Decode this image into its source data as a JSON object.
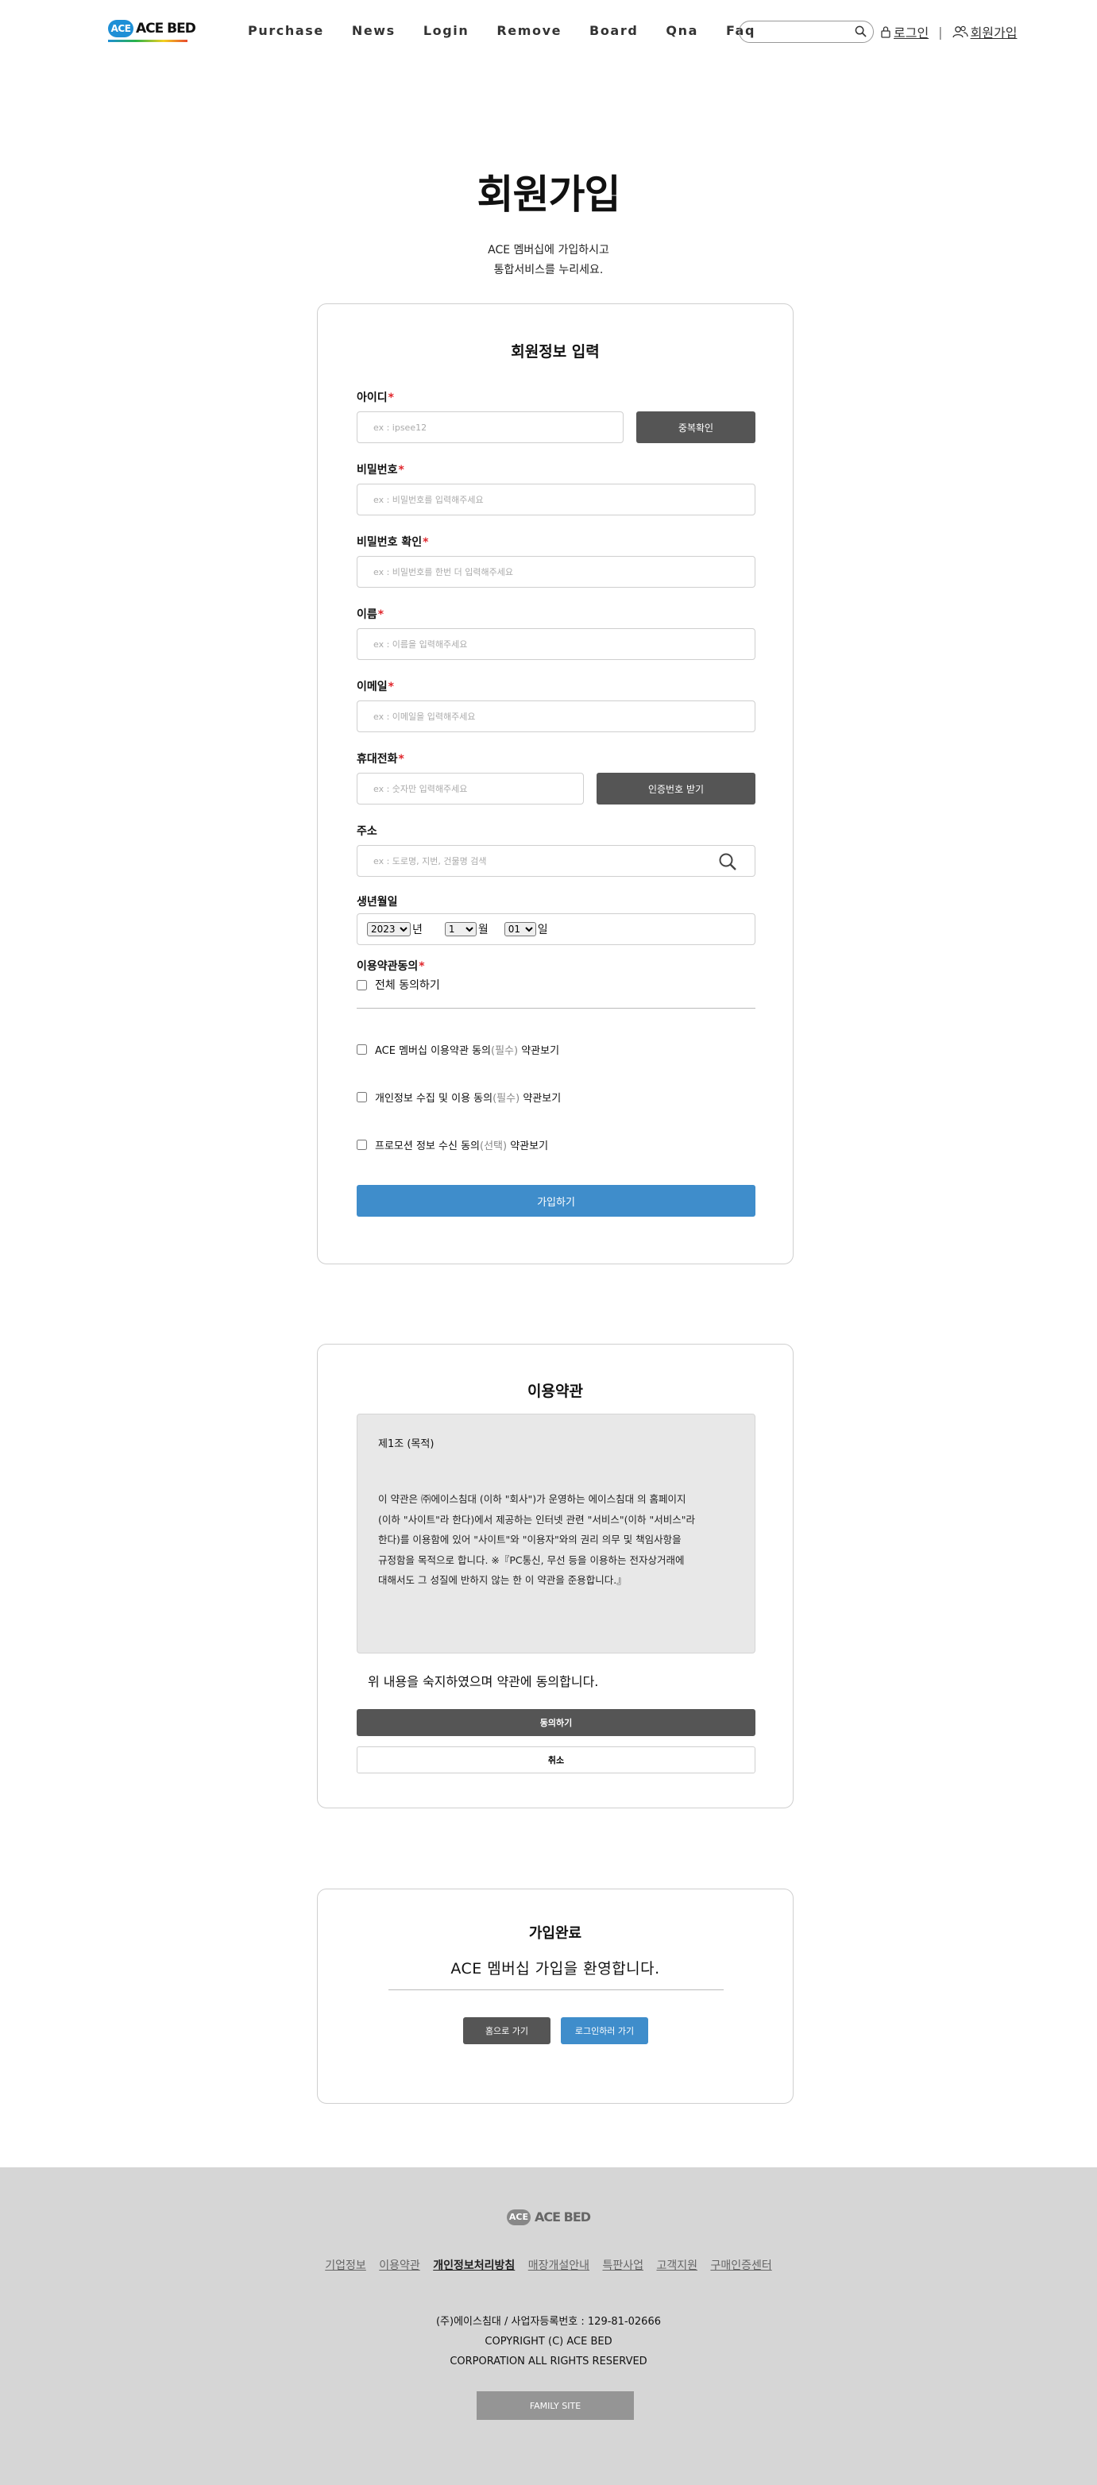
{
  "header": {
    "logo_badge": "ACE",
    "logo_text": "ACE BED",
    "nav": [
      "Purchase",
      "News",
      "Login",
      "Remove",
      "Board",
      "Qna",
      "Faq"
    ],
    "login_label": "로그인",
    "join_label": "회원가입"
  },
  "hero": {
    "title": "회원가입",
    "sub_line1": "ACE 멤버십에 가입하시고",
    "sub_line2": "통합서비스를 누리세요."
  },
  "form": {
    "title": "회원정보 입력",
    "id_label": "아이디",
    "id_placeholder": "ex : ipsee12",
    "dup_check": "중복확인",
    "pw_label": "비밀번호",
    "pw_placeholder": "ex : 비밀번호를 입력해주세요",
    "pw2_label": "비밀번호 확인",
    "pw2_placeholder": "ex : 비밀번호를 한번 더 입력해주세요",
    "name_label": "이름",
    "name_placeholder": "ex : 이름을 입력해주세요",
    "email_label": "이메일",
    "email_placeholder": "ex : 이메일을 입력해주세요",
    "phone_label": "휴대전화",
    "phone_placeholder": "ex : 숫자만 입력해주세요",
    "verify_button": "인증번호 받기",
    "addr_label": "주소",
    "addr_placeholder": "ex : 도로명, 지번, 건물명 검색",
    "birth_label": "생년월일",
    "birth_year": "2023",
    "birth_year_unit": "년",
    "birth_month": "1",
    "birth_month_unit": "월",
    "birth_day": "01",
    "birth_day_unit": "일",
    "agree_label": "이용약관동의",
    "agree_all": "전체 동의하기",
    "terms1_prefix": "ACE 멤버십 이용약관 동의",
    "terms1_opt": "(필수)",
    "terms1_view": "약관보기",
    "terms2_prefix": "개인정보 수집 및 이용 동의",
    "terms2_opt": "(필수)",
    "terms2_view": "약관보기",
    "terms3_prefix": "프로모션 정보 수신 동의",
    "terms3_opt": "(선택)",
    "terms3_view": "약관보기",
    "submit": "가입하기",
    "required_mark": "*"
  },
  "terms": {
    "title": "이용약관",
    "article": "제1조 (목적)",
    "line1": "이 약관은 ㈜에이스침대 (이하 \"회사\")가 운영하는 에이스침대 의 홈페이지",
    "line2": "(이하 \"사이트\"라 한다)에서 제공하는 인터넷 관련 \"서비스\"(이하 \"서비스\"라",
    "line3": "한다)를 이용함에 있어 \"사이트\"와 \"이용자\"와의 권리 의무 및 책임사항을",
    "line4": "규정함을 목적으로 합니다. ※『PC통신, 무선 등을 이용하는 전자상거래에",
    "line5": "대해서도 그 성질에 반하지 않는 한 이 약관을 준용합니다.』",
    "confirm_text": "위 내용을 숙지하였으며 약관에 동의합니다.",
    "agree_button": "동의하기",
    "cancel_button": "취소"
  },
  "complete": {
    "title": "가입완료",
    "message": "ACE 멤버십 가입을 환영합니다.",
    "home_button": "홈으로 가기",
    "login_button": "로그인하러 가기"
  },
  "footer": {
    "logo_badge": "ACE",
    "logo_text": "ACE BED",
    "links": [
      "기업정보",
      "이용약관",
      "개인정보처리방침",
      "매장개설안내",
      "특판사업",
      "고객지원",
      "구매인증센터"
    ],
    "company_line": "(주)에이스침대 / 사업자등록번호 : 129-81-02666",
    "copyright1": "COPYRIGHT (C) ACE BED",
    "copyright2": "CORPORATION ALL RIGHTS RESERVED",
    "family_site": "FAMILY SITE"
  },
  "colors": {
    "accent_blue": "#3f8dcb",
    "button_dark": "#555555",
    "required_red": "#e0262c",
    "footer_bg": "#d6d6d6"
  }
}
